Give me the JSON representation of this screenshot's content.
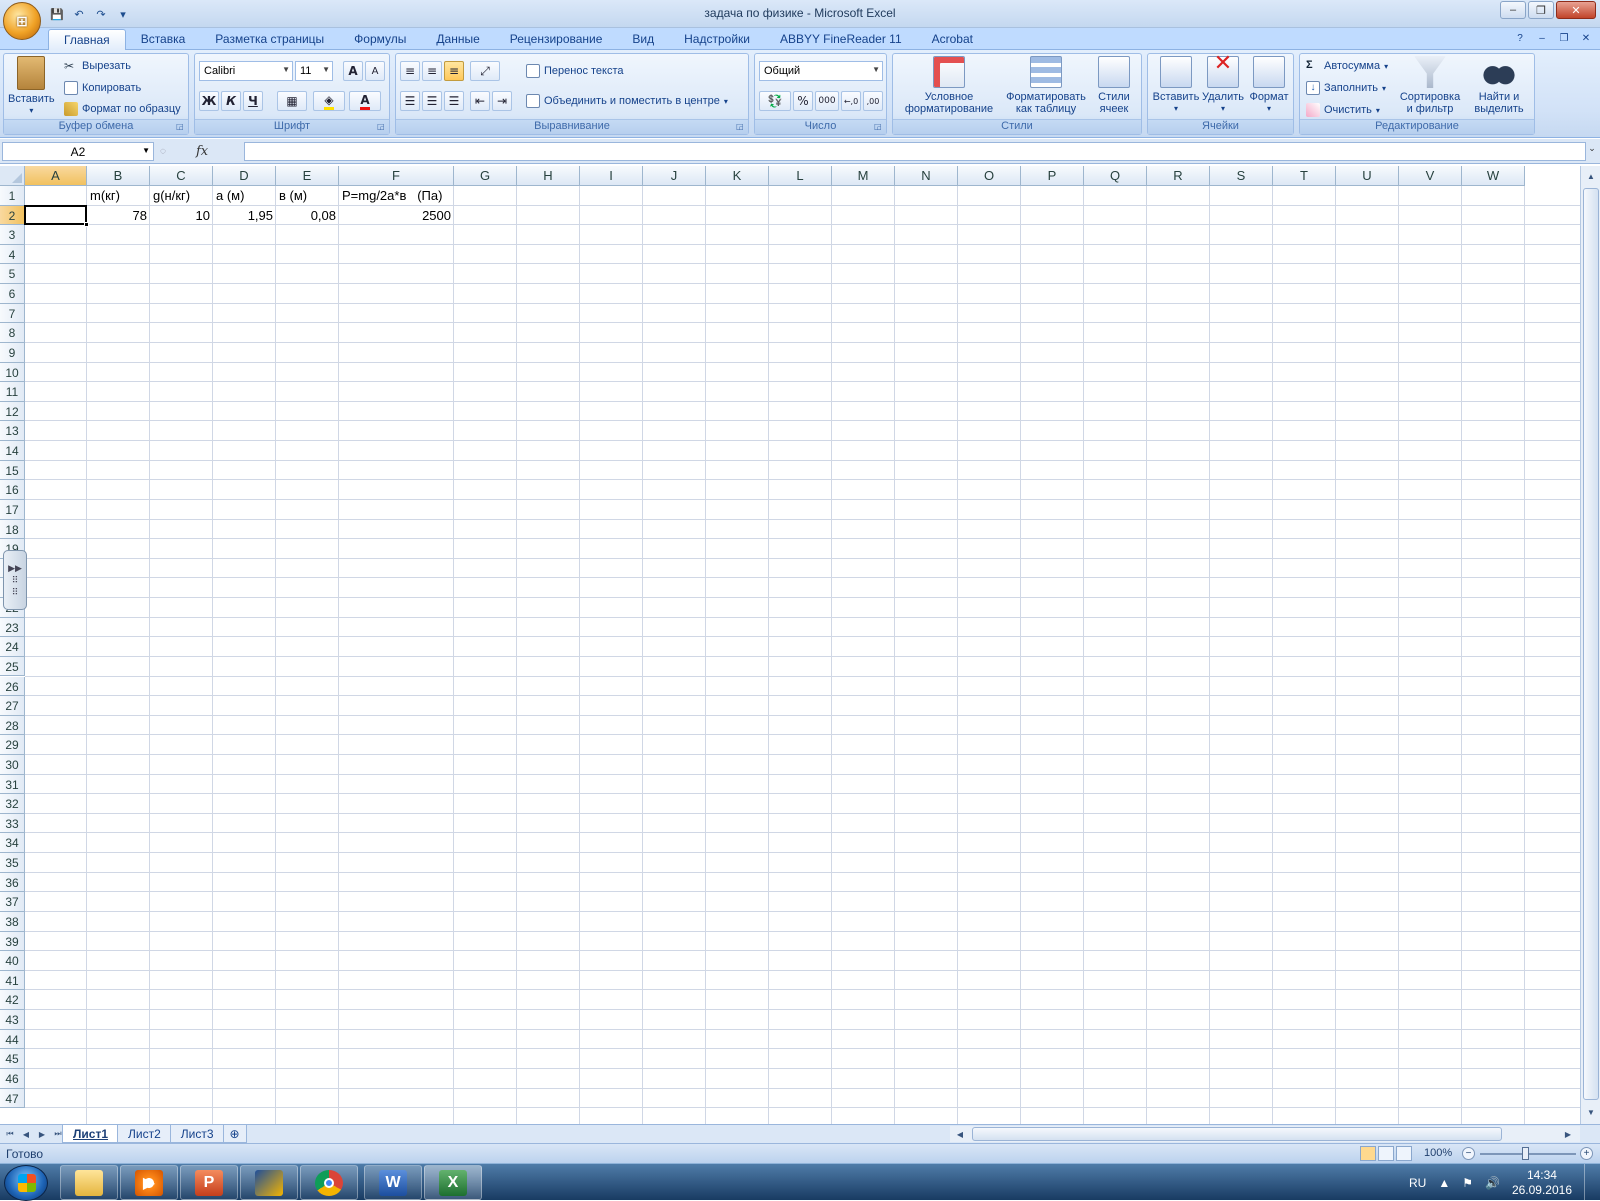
{
  "window": {
    "title": "задача по физике - Microsoft Excel",
    "minimize": "‒",
    "maximize": "❐",
    "close": "✕"
  },
  "office_button": {
    "label": "⊞"
  },
  "qat": {
    "save": "💾",
    "undo": "↶",
    "redo": "↷",
    "customize": "▾"
  },
  "tabs": [
    {
      "label": "Главная",
      "active": true
    },
    {
      "label": "Вставка"
    },
    {
      "label": "Разметка страницы"
    },
    {
      "label": "Формулы"
    },
    {
      "label": "Данные"
    },
    {
      "label": "Рецензирование"
    },
    {
      "label": "Вид"
    },
    {
      "label": "Надстройки"
    },
    {
      "label": "ABBYY FineReader 11"
    },
    {
      "label": "Acrobat"
    }
  ],
  "ribbon": {
    "clipboard": {
      "label": "Буфер обмена",
      "paste": "Вставить",
      "cut": "Вырезать",
      "copy": "Копировать",
      "format_painter": "Формат по образцу"
    },
    "font": {
      "label": "Шрифт",
      "font_name": "Calibri",
      "font_size": "11",
      "grow": "A",
      "shrink": "A",
      "bold": "Ж",
      "italic": "К",
      "underline": "Ч",
      "font_color": "A"
    },
    "alignment": {
      "label": "Выравнивание",
      "wrap_text": "Перенос текста",
      "merge_center": "Объединить и поместить в центре"
    },
    "number": {
      "label": "Число",
      "format": "Общий",
      "percent": "%",
      "thousands": "000",
      "inc_decimal": "←,0",
      "dec_decimal": ",00"
    },
    "styles": {
      "label": "Стили",
      "conditional_1": "Условное",
      "conditional_2": "форматирование",
      "as_table_1": "Форматировать",
      "as_table_2": "как таблицу",
      "cell_styles_1": "Стили",
      "cell_styles_2": "ячеек"
    },
    "cells": {
      "label": "Ячейки",
      "insert": "Вставить",
      "delete": "Удалить",
      "format": "Формат"
    },
    "editing": {
      "label": "Редактирование",
      "autosum": "Автосумма",
      "fill": "Заполнить",
      "clear": "Очистить",
      "sort_1": "Сортировка",
      "sort_2": "и фильтр",
      "find_1": "Найти и",
      "find_2": "выделить"
    }
  },
  "formula_bar": {
    "name_box": "A2",
    "fx": "fx",
    "formula": ""
  },
  "sheet": {
    "columns": [
      "A",
      "B",
      "C",
      "D",
      "E",
      "F",
      "G",
      "H",
      "I",
      "J",
      "K",
      "L",
      "M",
      "N",
      "O",
      "P",
      "Q",
      "R",
      "S",
      "T",
      "U",
      "V",
      "W"
    ],
    "active_column": "A",
    "active_row": 2,
    "rows": [
      "1",
      "2",
      "3",
      "4",
      "5",
      "6",
      "7",
      "8",
      "9",
      "10",
      "11",
      "12",
      "13",
      "14",
      "15",
      "16",
      "17",
      "18",
      "19",
      "20",
      "21",
      "22",
      "23",
      "24",
      "25",
      "26",
      "27",
      "28",
      "29",
      "30",
      "31",
      "32",
      "33",
      "34",
      "35",
      "36",
      "37",
      "38",
      "39",
      "40",
      "41",
      "42",
      "43",
      "44",
      "45",
      "46",
      "47"
    ],
    "cells": {
      "B1": "m(кг)",
      "C1": "g(н/кг)",
      "D1": "а (м)",
      "E1": "в (м)",
      "F1": "P=mg/2a*в   (Па)",
      "B2": "78",
      "C2": "10",
      "D2": "1,95",
      "E2": "0,08",
      "F2": "2500"
    },
    "side_handle": "19\n20\n21"
  },
  "sheet_tabs": [
    {
      "label": "Лист1",
      "active": true
    },
    {
      "label": "Лист2"
    },
    {
      "label": "Лист3"
    }
  ],
  "status": {
    "text": "Готово",
    "zoom": "100%"
  },
  "taskbar": {
    "apps": [
      "explorer",
      "media-player",
      "powerpoint",
      "app",
      "chrome",
      "word",
      "excel"
    ],
    "lang": "RU",
    "time": "14:34",
    "date": "26.09.2016"
  }
}
